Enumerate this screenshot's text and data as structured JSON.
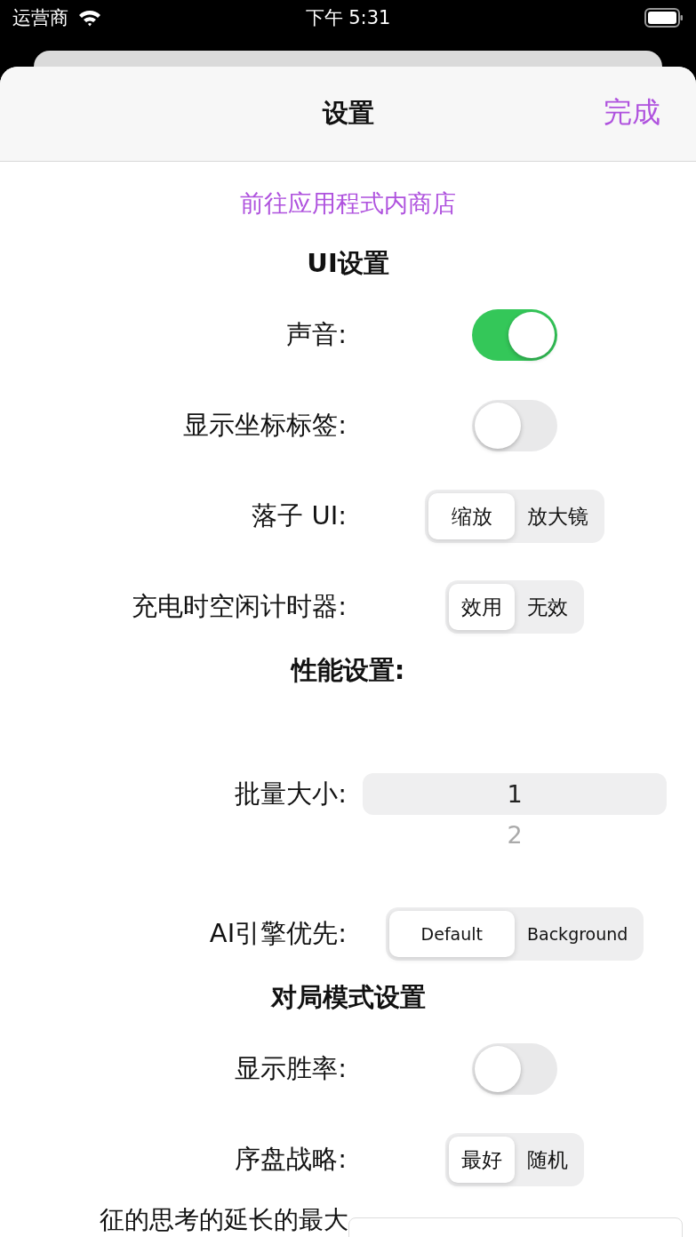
{
  "status_bar": {
    "carrier": "运营商",
    "time": "下午 5:31"
  },
  "nav": {
    "title": "设置",
    "done": "完成"
  },
  "rows": [
    {
      "kind": "link",
      "text": "前往应用程式内商店"
    },
    {
      "kind": "section",
      "text": "UI设置"
    },
    {
      "kind": "toggle",
      "label": "声音:",
      "on": true
    },
    {
      "kind": "toggle",
      "label": "显示坐标标签:",
      "on": false
    },
    {
      "kind": "segmented",
      "label": "落子 UI:",
      "options": [
        {
          "label": "缩放",
          "selected": true
        },
        {
          "label": "放大镜",
          "selected": false
        }
      ]
    },
    {
      "kind": "segmented",
      "label": "充电时空闲计时器:",
      "options": [
        {
          "label": "效用",
          "selected": true
        },
        {
          "label": "无效",
          "selected": false
        }
      ]
    },
    {
      "kind": "section",
      "text": "性能设置:"
    },
    {
      "kind": "picker",
      "label": "批量大小:",
      "options": [
        {
          "label": "1",
          "selected": true
        },
        {
          "label": "2",
          "selected": false
        }
      ]
    },
    {
      "kind": "segmented_small",
      "label": "AI引擎优先:",
      "options": [
        {
          "label": "Default",
          "selected": true
        },
        {
          "label": "Background",
          "selected": false
        }
      ]
    },
    {
      "kind": "section",
      "text": "对局模式设置"
    },
    {
      "kind": "toggle",
      "label": "显示胜率:",
      "on": false
    },
    {
      "kind": "segmented",
      "label": "序盘战略:",
      "options": [
        {
          "label": "最好",
          "selected": true
        },
        {
          "label": "随机",
          "selected": false
        }
      ]
    },
    {
      "kind": "field",
      "label": "征的思考的延长的最大"
    }
  ]
}
